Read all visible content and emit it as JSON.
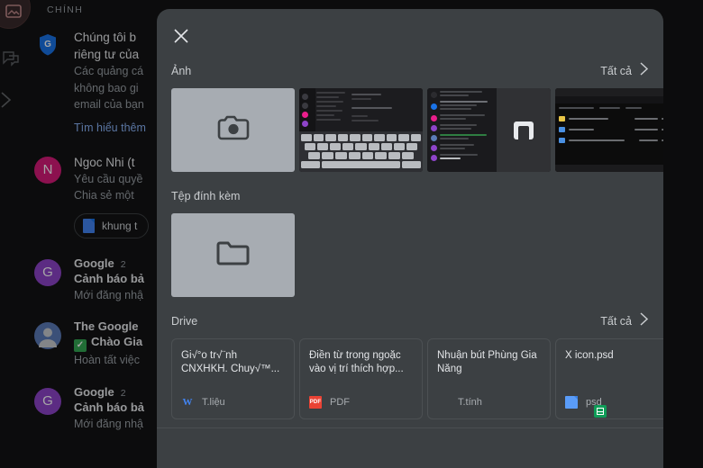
{
  "background": {
    "category_label": "CHÍNH",
    "rail": {
      "avatar_icon": "image-avatar-icon",
      "chat_icon": "chat-icon",
      "chevron_icon": "chevron-right-icon"
    },
    "emails": [
      {
        "avatar": {
          "letter": "G",
          "color": "#1a73e8",
          "shape": "shield"
        },
        "subject_line1": "Chúng tôi b",
        "subject_line2": "riêng tư của",
        "snippet1": "Các quảng cá",
        "snippet2": "không bao gi",
        "snippet3": "email của bạn",
        "link": "Tìm hiểu thêm"
      },
      {
        "avatar": {
          "letter": "N",
          "color": "#d81b7a",
          "shape": "circle"
        },
        "sender": "Ngoc Nhi (t",
        "snippet1": "Yêu cầu quyề",
        "snippet2": "Chia sẻ một ",
        "chip_label": "khung t"
      },
      {
        "avatar": {
          "letter": "G",
          "color": "#8e44c9",
          "shape": "circle"
        },
        "sender": "Google",
        "count": "2",
        "subject": "Cảnh báo bả",
        "snippet1": "Mới đăng nhậ"
      },
      {
        "avatar": {
          "letter": "",
          "color": "#5b7bb8",
          "shape": "person"
        },
        "sender": "The Google",
        "subject": "Chào Gia",
        "badge": "✓",
        "snippet1": "Hoàn tất việc"
      },
      {
        "avatar": {
          "letter": "G",
          "color": "#8e44c9",
          "shape": "circle"
        },
        "sender": "Google",
        "count": "2",
        "subject": "Cảnh báo bả",
        "snippet1": "Mới đăng nhậ"
      }
    ]
  },
  "sheet": {
    "close_icon": "close-icon",
    "sections": {
      "photos": {
        "title": "Ảnh",
        "all_label": "Tất cả",
        "all_icon": "chevron-right-icon",
        "tiles": [
          {
            "kind": "camera-placeholder",
            "icon": "camera-icon"
          },
          {
            "kind": "screenshot-keyboard"
          },
          {
            "kind": "screenshot-mail"
          },
          {
            "kind": "screenshot-files"
          }
        ]
      },
      "attachments": {
        "title": "Tệp đính kèm",
        "tiles": [
          {
            "kind": "folder-placeholder",
            "icon": "folder-icon"
          }
        ]
      },
      "drive": {
        "title": "Drive",
        "all_label": "Tất cả",
        "all_icon": "chevron-right-icon",
        "files": [
          {
            "name": "Gi√°o tr√¨nh CNXHKH. Chuy√™...",
            "type": "T.liệu",
            "icon": "word-doc-icon",
            "icon_glyph": "W"
          },
          {
            "name": "Điền từ trong ngoặc vào vị trí thích hợp...",
            "type": "PDF",
            "icon": "pdf-icon",
            "icon_glyph": "PDF"
          },
          {
            "name": "Nhuận bút Phùng Gia Năng",
            "type": "T.tính",
            "icon": "sheets-icon",
            "icon_glyph": ""
          },
          {
            "name": "X icon.psd",
            "type": "psd",
            "icon": "psd-file-icon",
            "icon_glyph": ""
          }
        ]
      }
    }
  },
  "colors": {
    "sheet_bg": "#3c4043",
    "app_bg": "#131314",
    "accent_link": "#8ab4f8",
    "placeholder": "#a7acb2"
  }
}
